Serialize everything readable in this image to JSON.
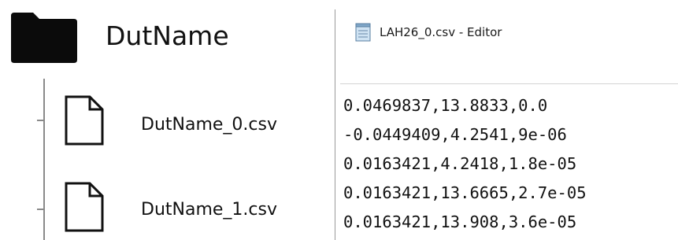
{
  "tree": {
    "folder": {
      "label": "DutName",
      "icon": "folder-icon"
    },
    "files": [
      {
        "label": "DutName_0.csv",
        "icon": "file-icon"
      },
      {
        "label": "DutName_1.csv",
        "icon": "file-icon"
      }
    ]
  },
  "editor": {
    "title": "LAH26_0.csv - Editor",
    "icon": "notepad-icon",
    "lines": [
      "0.0469837,13.8833,0.0",
      "-0.0449409,4.2541,9e-06",
      "0.0163421,4.2418,1.8e-05",
      "0.0163421,13.6665,2.7e-05",
      "0.0163421,13.908,3.6e-05"
    ]
  }
}
